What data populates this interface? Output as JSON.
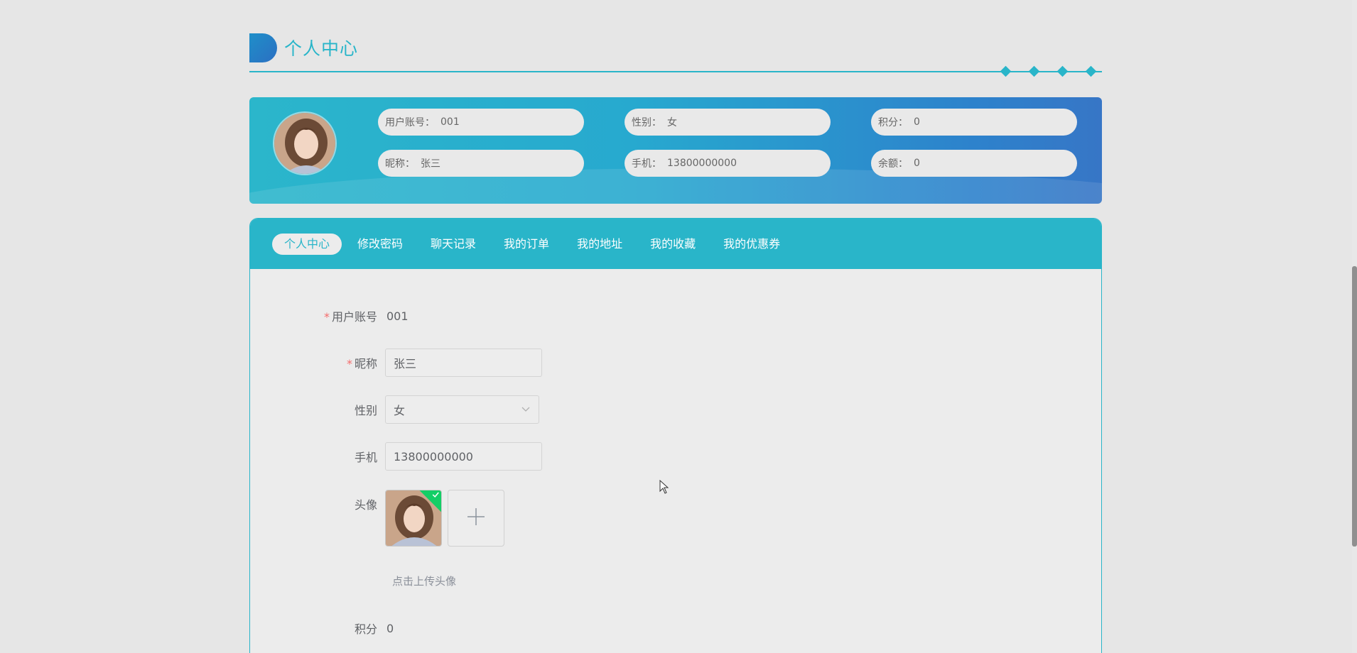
{
  "page": {
    "title": "个人中心"
  },
  "profile": {
    "fields": [
      {
        "key": "用户账号：",
        "value": "001"
      },
      {
        "key": "性别：",
        "value": "女"
      },
      {
        "key": "积分：",
        "value": "0"
      },
      {
        "key": "昵称：",
        "value": "张三"
      },
      {
        "key": "手机：",
        "value": "13800000000"
      },
      {
        "key": "余额：",
        "value": "0"
      }
    ]
  },
  "tabs": [
    {
      "label": "个人中心",
      "active": true
    },
    {
      "label": "修改密码",
      "active": false
    },
    {
      "label": "聊天记录",
      "active": false
    },
    {
      "label": "我的订单",
      "active": false
    },
    {
      "label": "我的地址",
      "active": false
    },
    {
      "label": "我的收藏",
      "active": false
    },
    {
      "label": "我的优惠券",
      "active": false
    }
  ],
  "form": {
    "account_label": "用户账号",
    "account_value": "001",
    "nickname_label": "昵称",
    "nickname_value": "张三",
    "gender_label": "性别",
    "gender_value": "女",
    "phone_label": "手机",
    "phone_value": "13800000000",
    "avatar_label": "头像",
    "upload_hint": "点击上传头像",
    "points_label": "积分",
    "points_value": "0",
    "required_mark": "*"
  },
  "icons": {
    "upload": "plus-icon",
    "select": "chevron-down-icon",
    "uploaded": "check-icon"
  },
  "colors": {
    "accent": "#29b5c9",
    "banner_end": "#3776c6",
    "required": "#f56c6c",
    "success": "#13ce66"
  }
}
